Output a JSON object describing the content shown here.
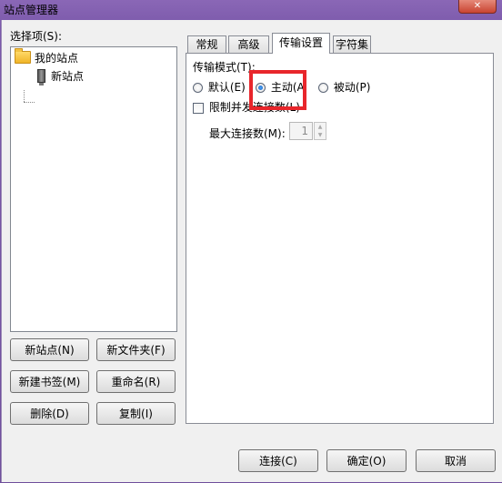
{
  "window": {
    "title": "站点管理器",
    "close_glyph": "✕"
  },
  "left": {
    "select_label": "选择项(S):",
    "tree": {
      "root": "我的站点",
      "child": "新站点"
    },
    "buttons": {
      "new_site": "新站点(N)",
      "new_folder": "新文件夹(F)",
      "new_bookmark": "新建书签(M)",
      "rename": "重命名(R)",
      "delete": "删除(D)",
      "copy": "复制(I)"
    }
  },
  "tabs": [
    {
      "label": "常规",
      "active": false
    },
    {
      "label": "高级",
      "active": false
    },
    {
      "label": "传输设置",
      "active": true
    },
    {
      "label": "字符集",
      "active": false
    }
  ],
  "transfer": {
    "mode_label": "传输模式(T):",
    "options": [
      {
        "label": "默认(E)",
        "checked": false
      },
      {
        "label": "主动(A",
        "checked": true
      },
      {
        "label": "被动(P)",
        "checked": false
      }
    ],
    "limit_label": "限制并发连接数(L)",
    "limit_checked": false,
    "max_label": "最大连接数(M):",
    "max_value": "1"
  },
  "footer": {
    "connect": "连接(C)",
    "ok": "确定(O)",
    "cancel": "取消"
  },
  "colors": {
    "highlight": "#e8262b",
    "accent": "#1c5fb8"
  }
}
